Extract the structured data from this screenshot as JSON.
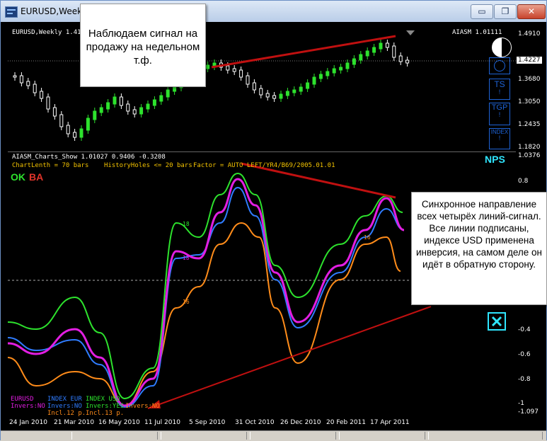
{
  "window": {
    "title": "EURUSD,Weekly",
    "minimize_glyph": "▭",
    "restore_glyph": "❐",
    "close_glyph": "✕"
  },
  "price_panel": {
    "header": "EURUSD,Weekly  1.41",
    "indicator_label": "AIASM 1.01111",
    "current_price": "1.4227",
    "price_ticks": [
      "1.4910",
      "1.4227",
      "1.3680",
      "1.3050",
      "1.2435",
      "1.1820"
    ],
    "buttons": [
      {
        "label": "TS",
        "sub": "!"
      },
      {
        "label": "TGP",
        "sub": "!"
      },
      {
        "label": "INDEX",
        "sub": "!"
      }
    ],
    "yin_yang_icon": "yin-yang-icon"
  },
  "indicator_panel": {
    "header": "AIASM_Charts_Show 1.01027 0.9406 -0.3208",
    "chart_length": "ChartLenth = 70 bars",
    "history_holes": "HistoryHoles <= 20 bars",
    "factor": "Factor = AUTO LEFT/YR4/B69/2005.01.01",
    "ok_label": "OK",
    "ba_label": "BA",
    "nps_label": "NPS",
    "value_ticks": [
      "1.0376",
      "0.8",
      "-0.4",
      "-0.6",
      "-0.8",
      "-1",
      "-1.097"
    ],
    "line_labels": [
      "18",
      "18",
      "16",
      "16"
    ],
    "bottom_labels": {
      "eurusd": "EURUSD",
      "index_eur": "INDEX EUR",
      "index_usd": "INDEX USD",
      "invers_no_1": "Invers:NO",
      "invers_no_2": "Invers:NO",
      "invers_yes": "Invers:YES",
      "invers_no_3": "Invers:NO",
      "incl_1": "Incl.12 p.",
      "incl_2": "Incl.13 p."
    }
  },
  "date_axis": [
    "24 Jan 2010",
    "21 Mar 2010",
    "16 May 2010",
    "11 Jul 2010",
    "5 Sep 2010",
    "31 Oct 2010",
    "26 Dec 2010",
    "20 Feb 2011",
    "17 Apr 2011"
  ],
  "callouts": {
    "top": "Наблюдаем сигнал на продажу на недельном т.ф.",
    "right": "Синхронное направление всех четырёх линий-сигнал. Все линии подписаны, индексе USD применена инверсия, на самом деле он идёт в обратную сторону."
  },
  "colors": {
    "green": "#2de22d",
    "magenta": "#e21ee2",
    "blue": "#2f7cff",
    "orange": "#ff8c1a",
    "red_arrow": "#c01010",
    "cyan": "#2fe6ff"
  }
}
